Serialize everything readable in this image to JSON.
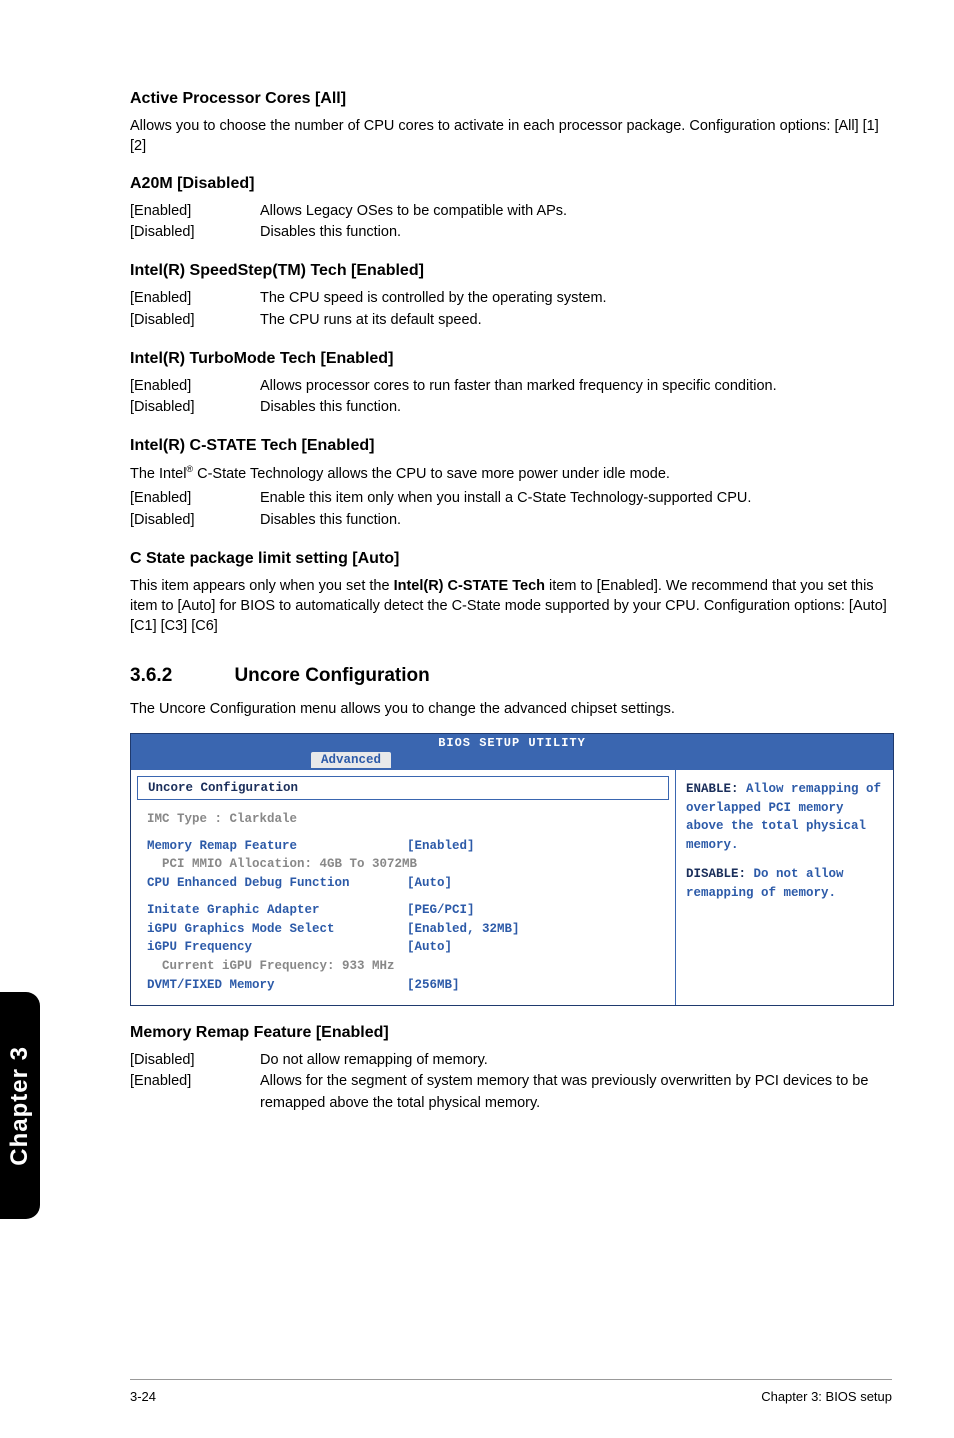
{
  "sections": {
    "active_processor": {
      "heading": "Active Processor Cores [All]",
      "text": "Allows you to choose the number of CPU cores to activate in each processor package. Configuration options: [All] [1] [2]"
    },
    "a20m": {
      "heading": "A20M [Disabled]",
      "opt1_key": "[Enabled]",
      "opt1_val": "Allows Legacy OSes to be compatible with APs.",
      "opt2_key": "[Disabled]",
      "opt2_val": "Disables this function."
    },
    "speedstep": {
      "heading": "Intel(R) SpeedStep(TM) Tech [Enabled]",
      "opt1_key": "[Enabled]",
      "opt1_val": "The CPU speed is controlled by the operating system.",
      "opt2_key": "[Disabled]",
      "opt2_val": "The CPU runs at its default speed."
    },
    "turbo": {
      "heading": "Intel(R) TurboMode Tech [Enabled]",
      "opt1_key": "[Enabled]",
      "opt1_val": "Allows processor cores to run faster than marked frequency in specific condition.",
      "opt2_key": "[Disabled]",
      "opt2_val": "Disables this function."
    },
    "cstate": {
      "heading": "Intel(R) C-STATE Tech [Enabled]",
      "intro_pre": "The Intel",
      "intro_sup": "®",
      "intro_post": " C-State Technology allows the CPU to save more power under idle mode.",
      "opt1_key": "[Enabled]",
      "opt1_val": "Enable this item only when you install a C-State Technology-supported CPU.",
      "opt2_key": "[Disabled]",
      "opt2_val": "Disables this function."
    },
    "cstate_pkg": {
      "heading": "C State package limit setting [Auto]",
      "text_pre": "This item appears only when you set the ",
      "text_bold": "Intel(R) C-STATE Tech",
      "text_post": " item to [Enabled]. We recommend that you set this item to [Auto] for BIOS to automatically detect the C-State mode supported by your CPU. Configuration options: [Auto] [C1] [C3] [C6]"
    }
  },
  "subsection": {
    "num": "3.6.2",
    "title": "Uncore Configuration",
    "intro": "The Uncore Configuration menu allows you to change the advanced chipset settings."
  },
  "bios": {
    "title": "BIOS SETUP UTILITY",
    "tab": "Advanced",
    "box_title": "Uncore Configuration",
    "imc": "IMC Type : Clarkdale",
    "rows": {
      "mem_remap_l": "Memory Remap Feature",
      "mem_remap_v": "[Enabled]",
      "pci_mmio": "  PCI MMIO Allocation: 4GB To 3072MB",
      "cpu_debug_l": "CPU Enhanced Debug Function",
      "cpu_debug_v": "[Auto]",
      "initate_l": "Initate Graphic Adapter",
      "initate_v": "[PEG/PCI]",
      "igpu_mode_l": "iGPU Graphics Mode Select",
      "igpu_mode_v": "[Enabled, 32MB]",
      "igpu_freq_l": "iGPU Frequency",
      "igpu_freq_v": "[Auto]",
      "cur_igpu": "  Current iGPU Frequency: 933 MHz",
      "dvmt_l": "DVMT/FIXED Memory",
      "dvmt_v": "[256MB]"
    },
    "help": {
      "l1": "ENABLE: Allow remapping of overlapped PCI memory above the total physical memory.",
      "l2": "DISABLE: Do not allow remapping of memory."
    }
  },
  "mem_remap": {
    "heading": "Memory Remap Feature [Enabled]",
    "opt1_key": "[Disabled]",
    "opt1_val": "Do not allow remapping of memory.",
    "opt2_key": "[Enabled]",
    "opt2_val": "Allows for the segment of system memory that was previously overwritten by PCI devices to be remapped above the total physical memory."
  },
  "sidebar": "Chapter 3",
  "footer": {
    "left": "3-24",
    "right": "Chapter 3: BIOS setup"
  }
}
